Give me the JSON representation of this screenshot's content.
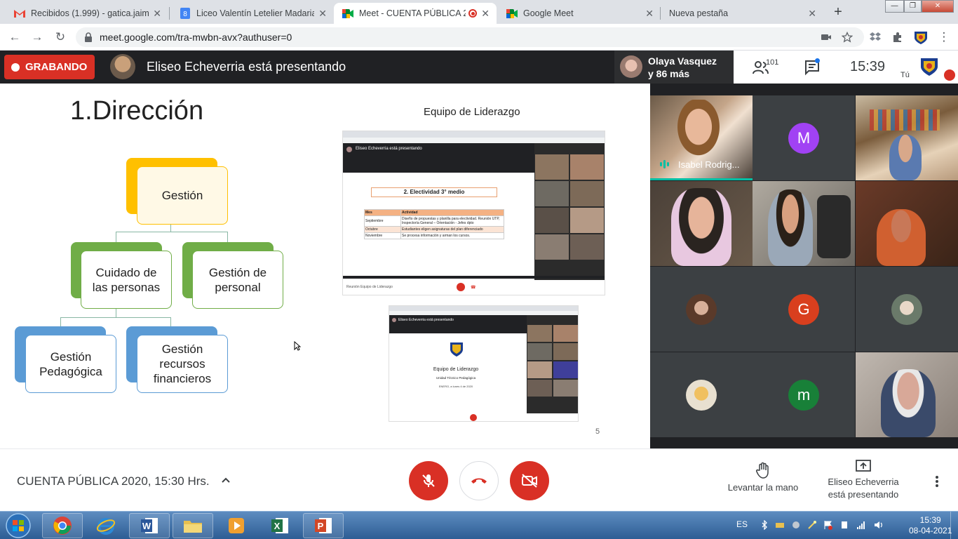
{
  "browser": {
    "tabs": [
      {
        "label": "Recibidos (1.999) - gatica.jaime",
        "icon": "gmail-icon"
      },
      {
        "label": "Liceo Valentín Letelier Madariag",
        "icon": "docs-icon"
      },
      {
        "label": "Meet - CUENTA PÚBLICA 20",
        "icon": "meet-icon"
      },
      {
        "label": "Google Meet",
        "icon": "meet-icon"
      },
      {
        "label": "Nueva pestaña",
        "icon": ""
      }
    ],
    "url": "meet.google.com/tra-mwbn-avx?authuser=0"
  },
  "meet": {
    "recording_label": "GRABANDO",
    "presenting_text": "Eliseo Echeverria está presentando",
    "other_participants": "Olaya Vasquez",
    "other_count_text": "y 86 más",
    "people_count": "101",
    "time": "15:39",
    "self_label": "Tú",
    "meeting_name": "CUENTA PÚBLICA 2020, 15:30 Hrs.",
    "raise_hand_label": "Levantar la mano",
    "presenter_line1": "Eliseo Echeverria",
    "presenter_line2": "está presentando"
  },
  "slide": {
    "title": "1.Dirección",
    "org_chart": {
      "root": "Gestión",
      "level2": [
        "Cuidado de las personas",
        "Gestión de personal"
      ],
      "level3": [
        "Gestión Pedagógica",
        "Gestión recursos financieros"
      ]
    },
    "right_label": "Equipo de Liderazgo",
    "shot1": {
      "presenting": "Eliseo Echeverria está presentando",
      "heading": "2. Electividad 3° medio",
      "table_headers": [
        "Mes",
        "Actividad"
      ],
      "rows": [
        [
          "Septiembre",
          "Diseño de propuestas y planilla para electividad. Reunión UTP, Inspectoría General – Orientación - Jefes dpto"
        ],
        [
          "Octubre",
          "Estudiantes eligen asignaturas del plan diferenciado"
        ],
        [
          "Noviembre",
          "Se procesa información y arman los cursos."
        ]
      ],
      "footer": "Reunión Equipo de Liderazgo"
    },
    "shot2": {
      "presenting": "Eliseo Echeverria está presentando",
      "title": "Equipo de Liderazgo",
      "subtitle": "Unidad Técnico Pedagógica",
      "date": "ENERO, a lunes 4 de 2020"
    },
    "page_number": "5"
  },
  "grid": {
    "tiles": [
      {
        "type": "video",
        "name": "Isabel Rodrig...",
        "speaking": true
      },
      {
        "type": "letter",
        "letter": "M",
        "color": "#a142f4"
      },
      {
        "type": "video"
      },
      {
        "type": "video"
      },
      {
        "type": "video"
      },
      {
        "type": "video"
      },
      {
        "type": "photo"
      },
      {
        "type": "letter",
        "letter": "G",
        "color": "#d93f1e"
      },
      {
        "type": "photo"
      },
      {
        "type": "photo"
      },
      {
        "type": "letter",
        "letter": "m",
        "color": "#188038"
      },
      {
        "type": "video"
      }
    ]
  },
  "taskbar": {
    "lang": "ES",
    "time": "15:39",
    "date": "08-04-2021"
  },
  "colors": {
    "record_red": "#d93025",
    "meet_dark": "#202124",
    "yellow": "#ffc000",
    "green": "#70ad47",
    "blue": "#5b9bd5"
  }
}
